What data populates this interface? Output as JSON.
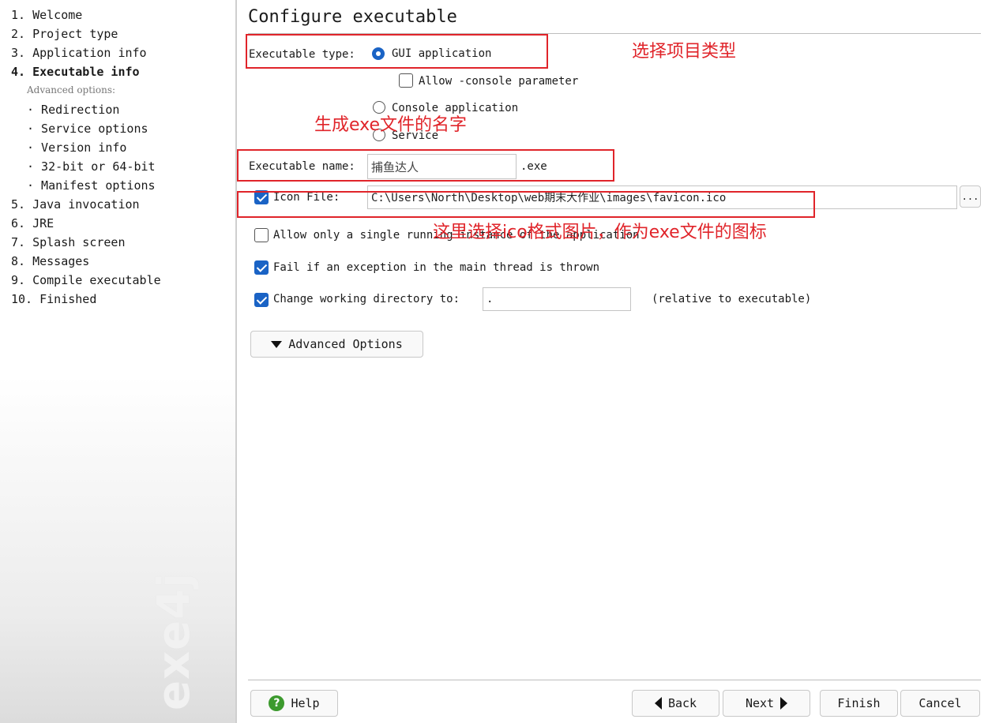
{
  "sidebar": {
    "steps": [
      "1. Welcome",
      "2. Project type",
      "3. Application info",
      "4. Executable info",
      "5. Java invocation",
      "6. JRE",
      "7. Splash screen",
      "8. Messages",
      "9. Compile executable",
      "10. Finished"
    ],
    "advanced_label": "Advanced options:",
    "advanced_items": [
      "· Redirection",
      "· Service options",
      "· Version info",
      "· 32-bit or 64-bit",
      "· Manifest options"
    ],
    "watermark": "exe4j"
  },
  "main": {
    "title": "Configure executable",
    "executable_type_label": "Executable type:",
    "type_options": [
      "GUI application",
      "Console application",
      "Service"
    ],
    "selected_type": "GUI application",
    "allow_console_label": "Allow -console parameter",
    "allow_console_checked": false,
    "executable_name_label": "Executable name:",
    "executable_name_value": "捕鱼达人",
    "exe_suffix": ".exe",
    "icon_file_label": "Icon File:",
    "icon_file_checked": true,
    "icon_file_value": "C:\\Users\\North\\Desktop\\web期末大作业\\images\\favicon.ico",
    "browse_label": "...",
    "single_instance_label": "Allow only a single running instance of the application",
    "single_instance_checked": false,
    "fail_exception_label": "Fail if an exception in the main thread is thrown",
    "fail_exception_checked": true,
    "change_dir_label": "Change working directory to:",
    "change_dir_checked": true,
    "change_dir_value": ".",
    "relative_note": "(relative to executable)",
    "advanced_button": "Advanced Options"
  },
  "footer": {
    "help": "Help",
    "back": "Back",
    "next": "Next",
    "finish": "Finish",
    "cancel": "Cancel"
  },
  "annotations": {
    "select_type": "选择项目类型",
    "exe_name": "生成exe文件的名字",
    "icon_hint": "这里选择ico格式图片，作为exe文件的图标",
    "color": "#e0242a"
  },
  "colors": {
    "accent": "#1a63c5",
    "help_green": "#3c9a2e"
  }
}
